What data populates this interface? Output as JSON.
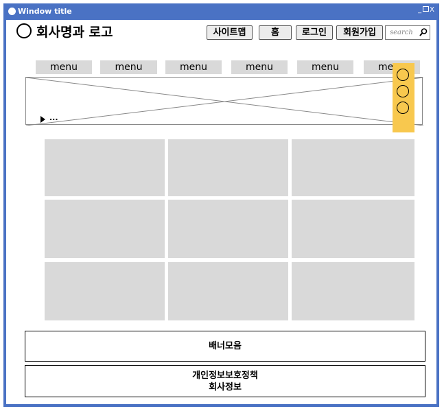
{
  "window": {
    "title": "Window title",
    "controls": {
      "minimize": "_",
      "close": "X"
    }
  },
  "header": {
    "logo_text": "회사명과 로고",
    "buttons": [
      "사이트맵",
      "홈",
      "로그인",
      "회원가입"
    ],
    "search_placeholder": "search"
  },
  "nav": {
    "items": [
      "menu",
      "menu",
      "menu",
      "menu",
      "menu",
      "menu"
    ]
  },
  "banner_slider": {
    "more_text": "..."
  },
  "footer": {
    "banner_label": "배너모음",
    "privacy_label": "개인정보보호정책",
    "company_label": "회사정보"
  },
  "colors": {
    "titlebar": "#4a72c4",
    "tile": "#d9d9d9",
    "indicator": "#f8c84e"
  },
  "icons": [
    "logo-circle-icon",
    "search-icon",
    "play-icon",
    "slide-indicator-icon"
  ]
}
